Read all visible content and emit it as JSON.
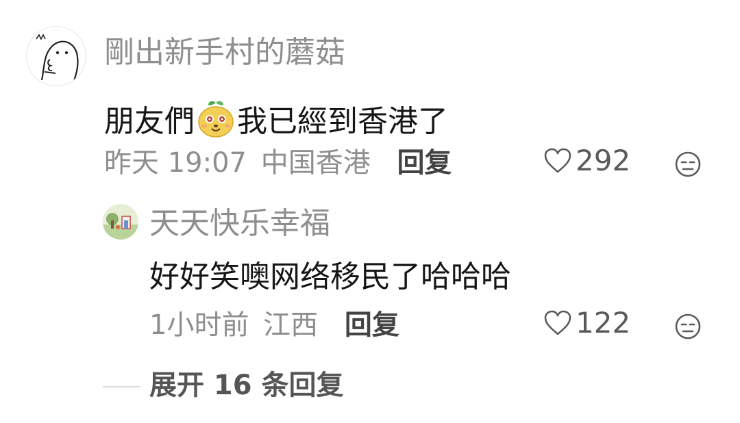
{
  "comment": {
    "username": "剛出新手村的蘑菇",
    "text_before": "朋友們",
    "emoji": "mushroom-face-emoji",
    "text_after": "我已經到香港了",
    "time": "昨天 19:07",
    "location": "中国香港",
    "reply_label": "回复",
    "likes": "292"
  },
  "reply": {
    "username": "天天快乐幸福",
    "text": "好好笑噢网络移民了哈哈哈",
    "time": "1小时前",
    "location": "江西",
    "reply_label": "回复",
    "likes": "122"
  },
  "expand_label": "展开 16 条回复",
  "colors": {
    "username": "#8e8e8e",
    "content": "#161616",
    "emoji_yellow": "#f2c94c"
  }
}
